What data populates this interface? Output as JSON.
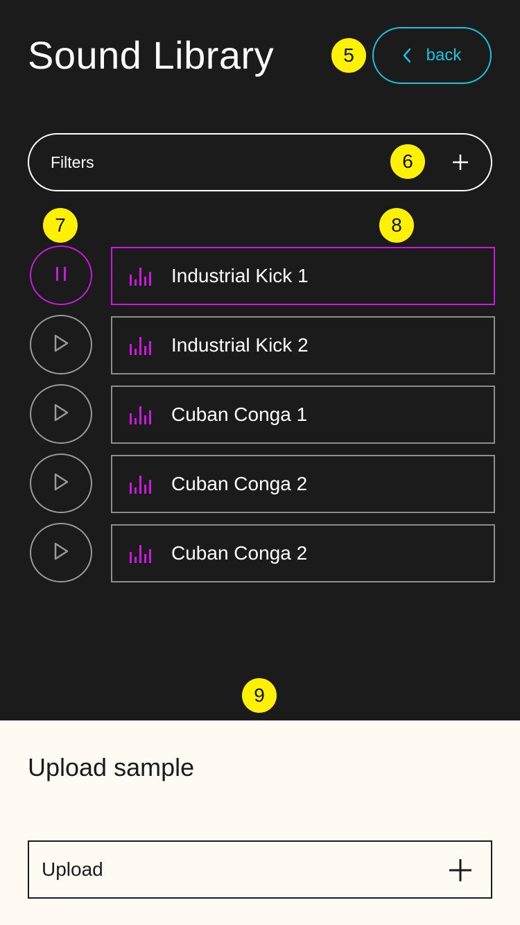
{
  "header": {
    "title": "Sound Library",
    "back_label": "back"
  },
  "filters": {
    "label": "Filters"
  },
  "annotations": [
    "5",
    "6",
    "7",
    "8",
    "9"
  ],
  "sounds": [
    {
      "name": "Industrial Kick 1",
      "state": "playing"
    },
    {
      "name": "Industrial Kick 2",
      "state": "paused"
    },
    {
      "name": "Cuban Conga 1",
      "state": "paused"
    },
    {
      "name": "Cuban Conga 2",
      "state": "paused"
    },
    {
      "name": "Cuban Conga 2",
      "state": "paused"
    }
  ],
  "upload": {
    "title": "Upload sample",
    "field_label": "Upload"
  },
  "icons": {
    "back": "chevron-left-icon",
    "filters_add": "plus-icon",
    "pause": "pause-icon",
    "play": "play-icon",
    "waveform": "waveform-icon",
    "upload_add": "plus-icon"
  },
  "colors": {
    "background": "#1b1b1b",
    "accent_cyan": "#16c3e0",
    "accent_magenta": "#cc18e0",
    "annotation_yellow": "#fff200",
    "panel": "#fffaf3"
  }
}
